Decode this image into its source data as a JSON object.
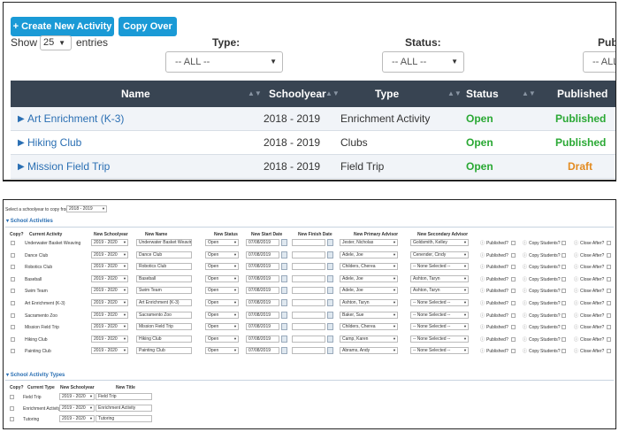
{
  "top": {
    "create_button": "+ Create New Activity",
    "copy_button": "Copy Over",
    "show_label": "Show",
    "entries_value": "25",
    "entries_label": "entries",
    "type_label": "Type:",
    "status_label": "Status:",
    "published_label": "Publi",
    "type_value": "-- ALL --",
    "status_value": "-- ALL --",
    "published_value": "-- ALL",
    "columns": [
      "Name",
      "Schoolyear",
      "Type",
      "Status",
      "Published"
    ],
    "rows": [
      {
        "name": "Art Enrichment (K-3)",
        "year": "2018 - 2019",
        "type": "Enrichment Activity",
        "status": "Open",
        "published": "Published"
      },
      {
        "name": "Hiking Club",
        "year": "2018 - 2019",
        "type": "Clubs",
        "status": "Open",
        "published": "Published"
      },
      {
        "name": "Mission Field Trip",
        "year": "2018 - 2019",
        "type": "Field Trip",
        "status": "Open",
        "published": "Draft"
      }
    ],
    "colors": {
      "accent": "#1a9ad6",
      "header": "#384452",
      "open": "#29a833",
      "published": "#29a833",
      "draft": "#e38b21",
      "link": "#2a6fb3"
    }
  },
  "bottom": {
    "copy_from_label": "Select a schoolyear to copy from:",
    "copy_from_value": "2018 - 2019",
    "activities_title": "School Activities",
    "act_headers": [
      "Copy?",
      "Current Activity",
      "New Schoolyear",
      "New Name",
      "New Status",
      "New Start Date",
      "New Finish Date",
      "New Primary Advisor",
      "New Secondary Advisor"
    ],
    "published_q": "Published?",
    "copy_students_q": "Copy Students?",
    "close_after_q": "Close After?",
    "activities": [
      {
        "current": "Underwater Basket Weaving",
        "year": "2019 - 2020",
        "name": "Underwater Basket Weavin",
        "status": "Open",
        "start": "07/08/2019",
        "finish": "",
        "primary": "Jester, Nicholas",
        "secondary": "Goldsmith, Kelley"
      },
      {
        "current": "Dance Club",
        "year": "2019 - 2020",
        "name": "Dance Club",
        "status": "Open",
        "start": "07/08/2019",
        "finish": "",
        "primary": "Adele, Joe",
        "secondary": "Cenender, Cindy"
      },
      {
        "current": "Robotics Club",
        "year": "2019 - 2020",
        "name": "Robotics Club",
        "status": "Open",
        "start": "07/08/2019",
        "finish": "",
        "primary": "Childers, Cherea",
        "secondary": "-- None Selected --"
      },
      {
        "current": "Baseball",
        "year": "2019 - 2020",
        "name": "Baseball",
        "status": "Open",
        "start": "07/08/2019",
        "finish": "",
        "primary": "Adele, Joe",
        "secondary": "Ashton, Taryn"
      },
      {
        "current": "Swim Team",
        "year": "2019 - 2020",
        "name": "Swim Team",
        "status": "Open",
        "start": "07/08/2019",
        "finish": "",
        "primary": "Adele, Joe",
        "secondary": "Ashton, Taryn"
      },
      {
        "current": "Art Enrichment (K-3)",
        "year": "2019 - 2020",
        "name": "Art Enrichment (K-3)",
        "status": "Open",
        "start": "07/08/2019",
        "finish": "",
        "primary": "Ashton, Taryn",
        "secondary": "-- None Selected --"
      },
      {
        "current": "Sacramento Zoo",
        "year": "2019 - 2020",
        "name": "Sacramento Zoo",
        "status": "Open",
        "start": "07/08/2019",
        "finish": "",
        "primary": "Baker, Sue",
        "secondary": "-- None Selected --"
      },
      {
        "current": "Mission Field Trip",
        "year": "2019 - 2020",
        "name": "Mission Field Trip",
        "status": "Open",
        "start": "07/08/2019",
        "finish": "",
        "primary": "Childers, Cherea",
        "secondary": "-- None Selected --"
      },
      {
        "current": "Hiking Club",
        "year": "2019 - 2020",
        "name": "Hiking Club",
        "status": "Open",
        "start": "07/08/2019",
        "finish": "",
        "primary": "Camp, Karen",
        "secondary": "-- None Selected --"
      },
      {
        "current": "Painting Club",
        "year": "2019 - 2020",
        "name": "Painting Club",
        "status": "Open",
        "start": "07/08/2019",
        "finish": "",
        "primary": "Abrams, Andy",
        "secondary": "-- None Selected --"
      }
    ],
    "types_title": "School Activity Types",
    "type_headers": [
      "Copy?",
      "Current Type",
      "New Schoolyear",
      "New Title"
    ],
    "types": [
      {
        "current": "Field Trip",
        "year": "2019 - 2020",
        "title": "Field Trip"
      },
      {
        "current": "Enrichment Activity",
        "year": "2019 - 2020",
        "title": "Enrichment Activity"
      },
      {
        "current": "Tutoring",
        "year": "2019 - 2020",
        "title": "Tutoring"
      }
    ]
  }
}
